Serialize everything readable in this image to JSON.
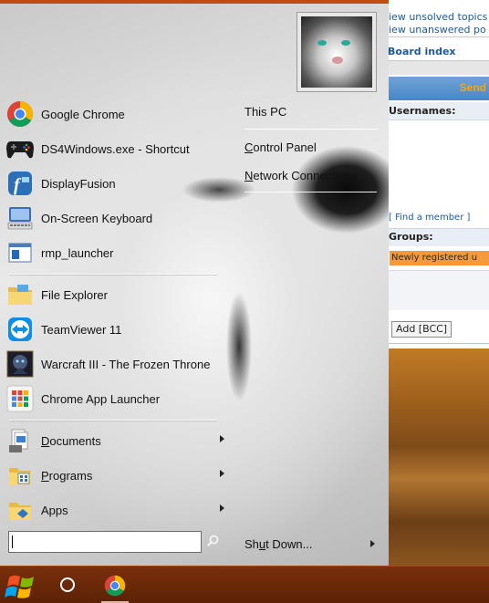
{
  "background_page": {
    "link1": "iew unsolved topics",
    "link2": "iew unanswered po",
    "board_index": "Board index",
    "send": "Send",
    "usernames_label": "Usernames:",
    "find_member": "[ Find a member ]",
    "groups_label": "Groups:",
    "group_value": "Newly registered u",
    "add_bcc": "Add [BCC]"
  },
  "pinned_programs": [
    {
      "label": "Google Chrome",
      "icon": "chrome-icon"
    },
    {
      "label": "DS4Windows.exe - Shortcut",
      "icon": "gamepad-icon"
    },
    {
      "label": "DisplayFusion",
      "icon": "displayfusion-icon"
    },
    {
      "label": "On-Screen Keyboard",
      "icon": "keyboard-icon"
    },
    {
      "label": "rmp_launcher",
      "icon": "app-window-icon"
    }
  ],
  "recent_programs": [
    {
      "label": "File Explorer",
      "icon": "folder-icon"
    },
    {
      "label": "TeamViewer 11",
      "icon": "teamviewer-icon"
    },
    {
      "label": "Warcraft III - The Frozen Throne",
      "icon": "warcraft-icon"
    },
    {
      "label": "Chrome App Launcher",
      "icon": "app-launcher-icon"
    }
  ],
  "folders": [
    {
      "label": "Documents",
      "accel": "D",
      "rest": "ocuments",
      "icon": "documents-icon"
    },
    {
      "label": "Programs",
      "accel": "P",
      "rest": "rograms",
      "icon": "programs-icon"
    },
    {
      "label": "Apps",
      "accel": "",
      "rest": "Apps",
      "icon": "apps-icon"
    }
  ],
  "right_pane": {
    "this_pc": "This PC",
    "control_panel_accel": "C",
    "control_panel_rest": "ontrol Panel",
    "network_accel": "N",
    "network_rest": "etwork Connections",
    "shutdown_pre": "Sh",
    "shutdown_accel": "u",
    "shutdown_rest": "t Down..."
  },
  "search": {
    "value": ""
  },
  "colors": {
    "taskbar": "#5b2206",
    "accent": "#c24b12",
    "link": "#1b5a9b",
    "group_highlight": "#f49a3c"
  }
}
